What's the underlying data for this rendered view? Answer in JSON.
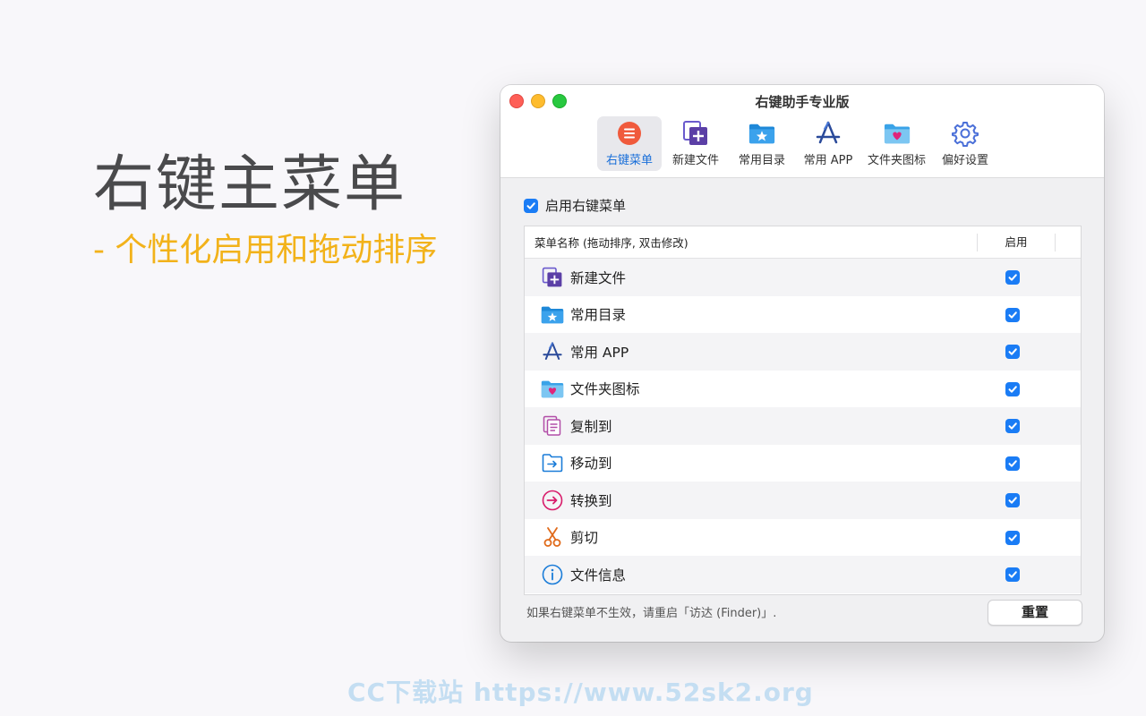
{
  "hero": {
    "title": "右键主菜单",
    "subtitle": "- 个性化启用和拖动排序"
  },
  "watermark": "CC下载站  https://www.52sk2.org",
  "window": {
    "title": "右键助手专业版",
    "toolbar": [
      {
        "label": "右键菜单",
        "icon": "menu-list-icon",
        "active": true
      },
      {
        "label": "新建文件",
        "icon": "new-file-icon",
        "active": false
      },
      {
        "label": "常用目录",
        "icon": "folder-star-icon",
        "active": false
      },
      {
        "label": "常用 APP",
        "icon": "app-store-icon",
        "active": false
      },
      {
        "label": "文件夹图标",
        "icon": "folder-heart-icon",
        "active": false
      },
      {
        "label": "偏好设置",
        "icon": "gear-icon",
        "active": false
      }
    ],
    "enable_menu": {
      "label": "启用右键菜单",
      "checked": true
    },
    "table": {
      "headers": {
        "name": "菜单名称 (拖动排序, 双击修改)",
        "enable": "启用"
      },
      "rows": [
        {
          "label": "新建文件",
          "icon": "new-file-icon",
          "enabled": true
        },
        {
          "label": "常用目录",
          "icon": "folder-star-icon",
          "enabled": true
        },
        {
          "label": "常用 APP",
          "icon": "app-store-icon",
          "enabled": true
        },
        {
          "label": "文件夹图标",
          "icon": "folder-heart-icon",
          "enabled": true
        },
        {
          "label": "复制到",
          "icon": "copy-icon",
          "enabled": true
        },
        {
          "label": "移动到",
          "icon": "move-folder-icon",
          "enabled": true
        },
        {
          "label": "转换到",
          "icon": "convert-arrow-icon",
          "enabled": true
        },
        {
          "label": "剪切",
          "icon": "scissors-icon",
          "enabled": true
        },
        {
          "label": "文件信息",
          "icon": "info-icon",
          "enabled": true
        }
      ]
    },
    "footer_note": "如果右键菜单不生效，请重启「访达 (Finder)」.",
    "reset_label": "重置"
  },
  "colors": {
    "accent": "#1a7cf5",
    "hero_subtitle": "#f2b21a",
    "hero_title": "#4a4a4c"
  }
}
